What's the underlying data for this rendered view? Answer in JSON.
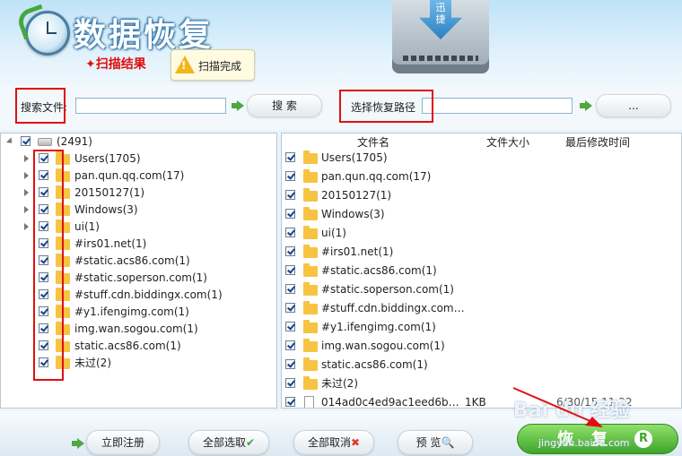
{
  "header": {
    "app_title": "数据恢复",
    "scan_result": "✦扫描结果",
    "scan_status": "扫描完成",
    "drive_brand": "迅捷"
  },
  "search": {
    "file_label": "搜索文件:",
    "file_value": "",
    "search_button": "搜 索",
    "path_label": "选择恢复路径",
    "path_value": "",
    "browse_button": "..."
  },
  "tree": {
    "root_label": "(2491)",
    "items": [
      {
        "label": "Users(1705)",
        "expandable": true
      },
      {
        "label": "pan.qun.qq.com(17)",
        "expandable": true
      },
      {
        "label": "20150127(1)",
        "expandable": true
      },
      {
        "label": "Windows(3)",
        "expandable": true
      },
      {
        "label": "ui(1)",
        "expandable": true
      },
      {
        "label": "#irs01.net(1)",
        "expandable": false
      },
      {
        "label": "#static.acs86.com(1)",
        "expandable": false
      },
      {
        "label": "#static.soperson.com(1)",
        "expandable": false
      },
      {
        "label": "#stuff.cdn.biddingx.com(1)",
        "expandable": false
      },
      {
        "label": "#y1.ifengimg.com(1)",
        "expandable": false
      },
      {
        "label": "img.wan.sogou.com(1)",
        "expandable": false
      },
      {
        "label": "static.acs86.com(1)",
        "expandable": false
      },
      {
        "label": "未过(2)",
        "expandable": false
      }
    ]
  },
  "files": {
    "columns": {
      "name": "文件名",
      "size": "文件大小",
      "modified": "最后修改时间"
    },
    "rows": [
      {
        "name": "Users(1705)",
        "size": "",
        "modified": "",
        "type": "folder"
      },
      {
        "name": "pan.qun.qq.com(17)",
        "size": "",
        "modified": "",
        "type": "folder"
      },
      {
        "name": "20150127(1)",
        "size": "",
        "modified": "",
        "type": "folder"
      },
      {
        "name": "Windows(3)",
        "size": "",
        "modified": "",
        "type": "folder"
      },
      {
        "name": "ui(1)",
        "size": "",
        "modified": "",
        "type": "folder"
      },
      {
        "name": "#irs01.net(1)",
        "size": "",
        "modified": "",
        "type": "folder"
      },
      {
        "name": "#static.acs86.com(1)",
        "size": "",
        "modified": "",
        "type": "folder"
      },
      {
        "name": "#static.soperson.com(1)",
        "size": "",
        "modified": "",
        "type": "folder"
      },
      {
        "name": "#stuff.cdn.biddingx.com…",
        "size": "",
        "modified": "",
        "type": "folder"
      },
      {
        "name": "#y1.ifengimg.com(1)",
        "size": "",
        "modified": "",
        "type": "folder"
      },
      {
        "name": "img.wan.sogou.com(1)",
        "size": "",
        "modified": "",
        "type": "folder"
      },
      {
        "name": "static.acs86.com(1)",
        "size": "",
        "modified": "",
        "type": "folder"
      },
      {
        "name": "未过(2)",
        "size": "",
        "modified": "",
        "type": "folder"
      },
      {
        "name": "014ad0c4ed9ac1eed6b…",
        "size": "1KB",
        "modified": "6/30/15 11:22",
        "type": "file"
      }
    ]
  },
  "bottom": {
    "register": "立即注册",
    "select_all": "全部选取",
    "deselect_all": "全部取消",
    "preview": "预 览",
    "recover": "恢复",
    "recover_badge": "R"
  },
  "watermark": {
    "main": "Bai du 经验",
    "sub": "jingyan.baidu.com"
  },
  "colors": {
    "highlight": "#e01010",
    "accent": "#3ea52a",
    "header": "#bfe3f7"
  }
}
